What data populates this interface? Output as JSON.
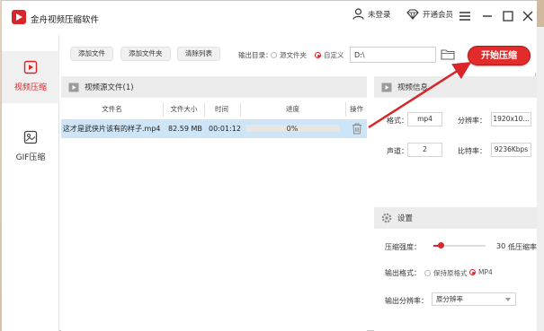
{
  "app": {
    "title": "金舟视频压缩软件"
  },
  "titlebar": {
    "login_label": "未登录",
    "vip_label": "开通会员"
  },
  "sidebar": {
    "items": [
      {
        "label": "视频压缩",
        "icon": "play-square-icon",
        "active": true
      },
      {
        "label": "GIF压缩",
        "icon": "gif-image-icon",
        "active": false
      }
    ]
  },
  "toolbar": {
    "add_file": "添加文件",
    "add_folder": "添加文件夹",
    "clear_list": "清除列表",
    "output_dir_label": "输出目录：",
    "option_source_folder": "源文件夹",
    "option_custom": "自定义",
    "output_path": "D:\\",
    "start_button": "开始压缩"
  },
  "file_list": {
    "header": "视频源文件(1)",
    "columns": [
      "文件名",
      "文件大小",
      "时间",
      "进度",
      "操作"
    ],
    "rows": [
      {
        "name": "这才是武侠片该有的样子.mp4",
        "size": "82.59 MB",
        "duration": "00:01:12",
        "progress": "0%"
      }
    ]
  },
  "video_info": {
    "header": "视频信息",
    "format_label": "格式：",
    "format_value": "mp4",
    "resolution_label": "分辨率：",
    "resolution_value": "1920x10...",
    "channels_label": "声道：",
    "channels_value": "2",
    "bitrate_label": "比特率：",
    "bitrate_value": "9236Kbps"
  },
  "settings": {
    "header": "设置",
    "strength_label": "压缩强度：",
    "strength_value": "30",
    "strength_desc": "低压缩率",
    "output_format_label": "输出格式：",
    "format_keep": "保持原格式",
    "format_mp4": "MP4",
    "output_resolution_label": "输出分辨率：",
    "output_resolution_value": "原分辨率"
  },
  "colors": {
    "accent": "#d9262b",
    "row_selected": "#cde5f7",
    "panel_header": "#ececec"
  }
}
